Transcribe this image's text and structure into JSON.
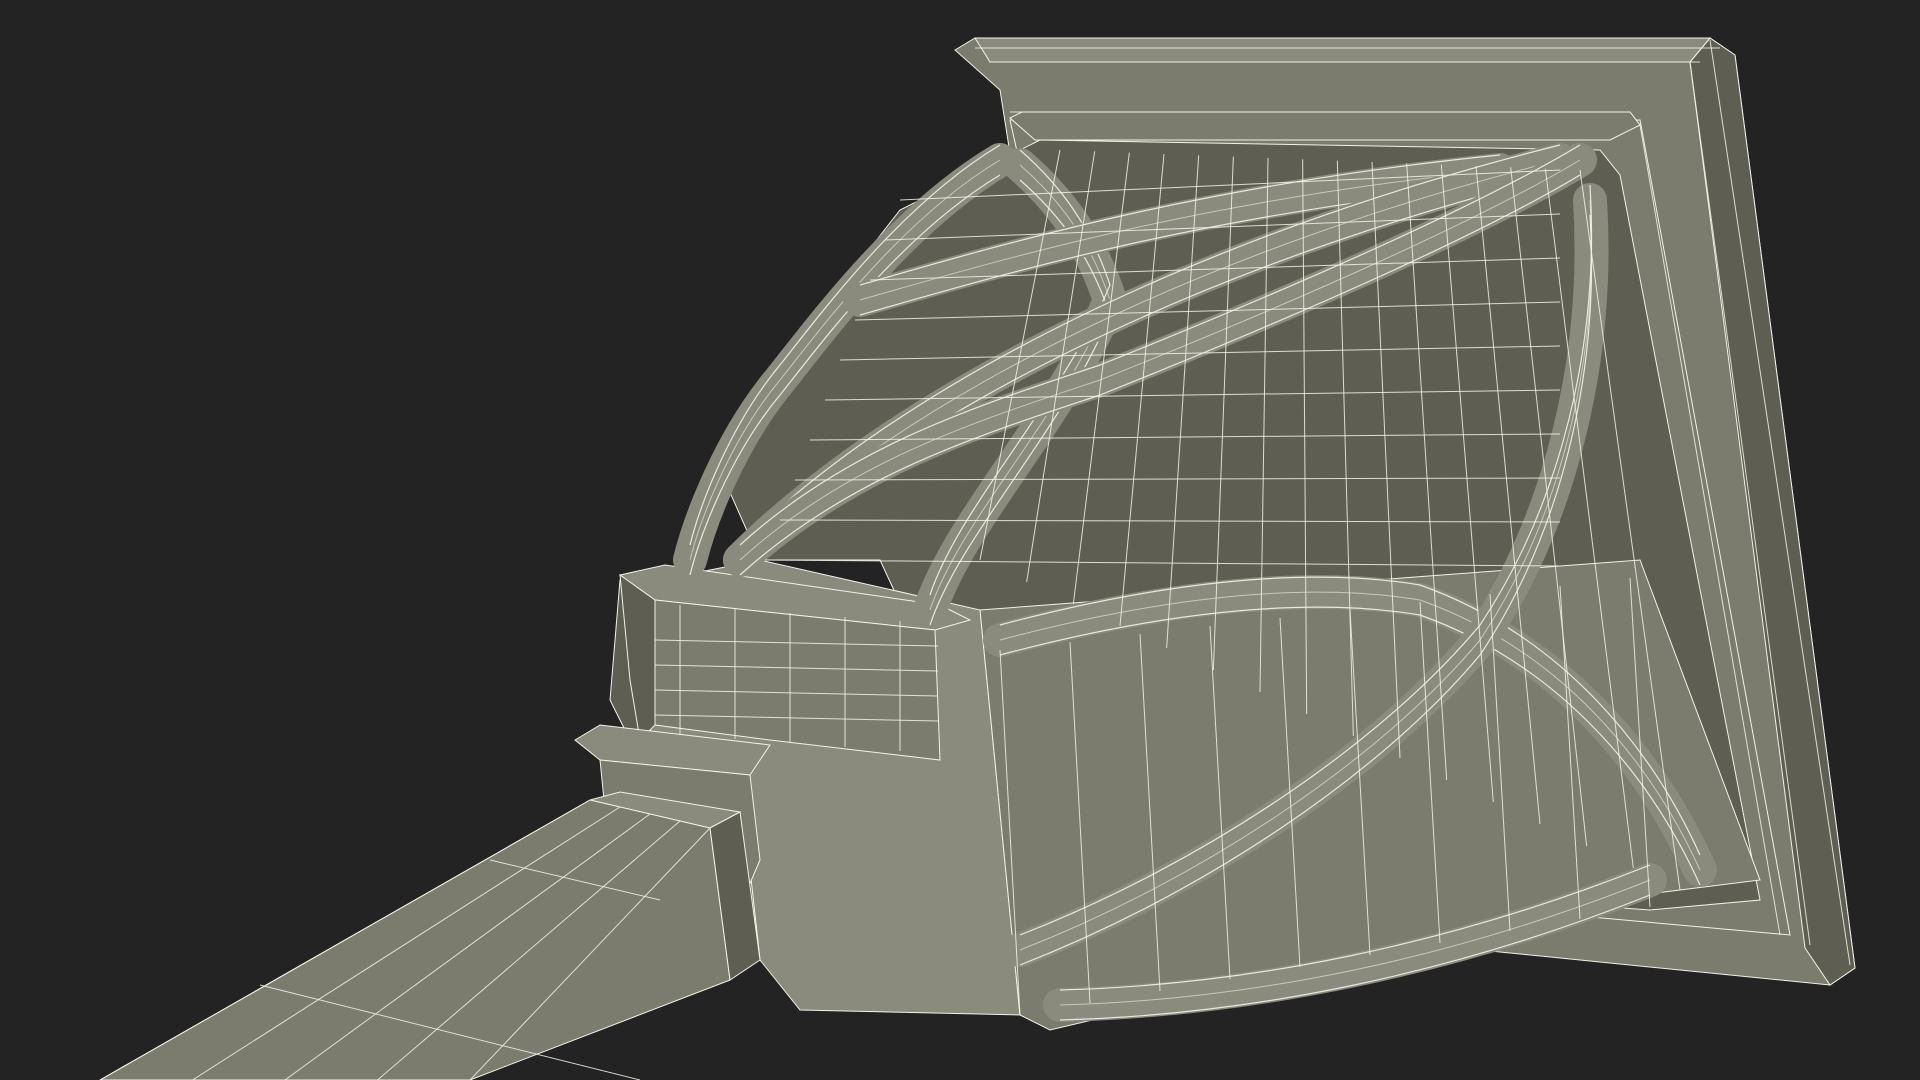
{
  "scene": {
    "background_color": "#232323",
    "surface_color": "#7b7b6e",
    "surface_light_color": "#8a8a7d",
    "surface_dark_color": "#5e5e53",
    "wire_color": "#f2f2e8"
  }
}
